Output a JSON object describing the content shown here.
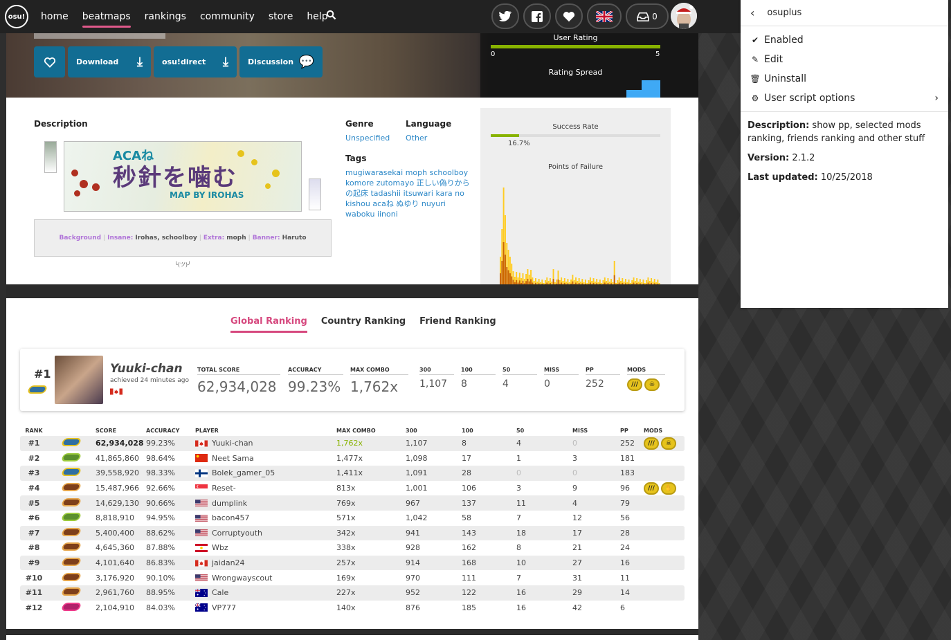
{
  "nav": {
    "logo": "osu!",
    "links": [
      "home",
      "beatmaps",
      "rankings",
      "community",
      "store",
      "help"
    ],
    "active": "beatmaps",
    "inbox_count": "0"
  },
  "header": {
    "buttons": {
      "download": "Download",
      "osudirect": "osu!direct",
      "discussion": "Discussion"
    },
    "user_rating": {
      "label": "User Rating",
      "min": "0",
      "max": "5"
    },
    "rating_spread": {
      "label": "Rating Spread"
    }
  },
  "info": {
    "description_label": "Description",
    "banner_text": {
      "line1": "ACAね",
      "line2": "秒針を噛む",
      "line3": "MAP BY IROHAS"
    },
    "credits": [
      {
        "key": "Background",
        "value": ""
      },
      {
        "key": "Insane:",
        "value": "Irohas, schoolboy"
      },
      {
        "key": "Extra:",
        "value": "moph"
      },
      {
        "key": "Banner:",
        "value": "Haruto"
      }
    ],
    "kaomoji": "╰(ツ)╯",
    "genre_label": "Genre",
    "genre_value": "Unspecified",
    "language_label": "Language",
    "language_value": "Other",
    "tags_label": "Tags",
    "tags": "mugiwarasekai moph schoolboy komore zutomayo 正しい偽りからの起床 tadashii itsuwari kara no kishou acaね ぬゆり nuyuri waboku iinoni",
    "success_rate_label": "Success Rate",
    "success_rate": "16.7%",
    "success_rate_value": 0.167,
    "points_of_failure_label": "Points of Failure"
  },
  "ranking": {
    "tabs": [
      "Global Ranking",
      "Country Ranking",
      "Friend Ranking"
    ],
    "active_tab": "Global Ranking",
    "top": {
      "rank": "#1",
      "name": "Yuuki-chan",
      "achieved": "achieved 24 minutes ago",
      "stats": [
        {
          "label": "TOTAL SCORE",
          "value": "62,934,028"
        },
        {
          "label": "ACCURACY",
          "value": "99.23%"
        },
        {
          "label": "MAX COMBO",
          "value": "1,762x"
        },
        {
          "label": "300",
          "value": "1,107"
        },
        {
          "label": "100",
          "value": "8"
        },
        {
          "label": "50",
          "value": "4"
        },
        {
          "label": "MISS",
          "value": "0"
        },
        {
          "label": "PP",
          "value": "252"
        },
        {
          "label": "MODS",
          "value": ""
        }
      ]
    },
    "headers": [
      "RANK",
      "",
      "SCORE",
      "ACCURACY",
      "PLAYER",
      "MAX COMBO",
      "300",
      "100",
      "50",
      "MISS",
      "PP",
      "MODS"
    ],
    "rows": [
      {
        "rank": "#1",
        "grade": "S",
        "score": "62,934,028",
        "acc": "99.23%",
        "flag": "ca",
        "player": "Yuuki-chan",
        "combo": "1,762x",
        "c300": "1,107",
        "c100": "8",
        "c50": "4",
        "miss": "0",
        "pp": "252",
        "mods": [
          "HR",
          "SD"
        ]
      },
      {
        "rank": "#2",
        "grade": "A",
        "score": "41,865,860",
        "acc": "98.64%",
        "flag": "cn",
        "player": "Neet Sama",
        "combo": "1,477x",
        "c300": "1,098",
        "c100": "17",
        "c50": "1",
        "miss": "3",
        "pp": "181",
        "mods": []
      },
      {
        "rank": "#3",
        "grade": "S",
        "score": "39,558,920",
        "acc": "98.33%",
        "flag": "fi",
        "player": "Bolek_gamer_05",
        "combo": "1,411x",
        "c300": "1,091",
        "c100": "28",
        "c50": "0",
        "miss": "0",
        "pp": "183",
        "mods": []
      },
      {
        "rank": "#4",
        "grade": "B",
        "score": "15,487,966",
        "acc": "92.66%",
        "flag": "sg",
        "player": "Reset-",
        "combo": "813x",
        "c300": "1,001",
        "c100": "106",
        "c50": "3",
        "miss": "9",
        "pp": "96",
        "mods": [
          "HR",
          "RX"
        ]
      },
      {
        "rank": "#5",
        "grade": "B",
        "score": "14,629,130",
        "acc": "90.66%",
        "flag": "us",
        "player": "dumplink",
        "combo": "769x",
        "c300": "967",
        "c100": "137",
        "c50": "11",
        "miss": "4",
        "pp": "79",
        "mods": []
      },
      {
        "rank": "#6",
        "grade": "A",
        "score": "8,818,910",
        "acc": "94.95%",
        "flag": "us",
        "player": "bacon457",
        "combo": "571x",
        "c300": "1,042",
        "c100": "58",
        "c50": "7",
        "miss": "12",
        "pp": "56",
        "mods": []
      },
      {
        "rank": "#7",
        "grade": "B",
        "score": "5,400,400",
        "acc": "88.62%",
        "flag": "us",
        "player": "Corruptyouth",
        "combo": "342x",
        "c300": "941",
        "c100": "143",
        "c50": "18",
        "miss": "17",
        "pp": "28",
        "mods": []
      },
      {
        "rank": "#8",
        "grade": "B",
        "score": "4,645,360",
        "acc": "87.88%",
        "flag": "pf",
        "player": "Wbz",
        "combo": "338x",
        "c300": "928",
        "c100": "162",
        "c50": "8",
        "miss": "21",
        "pp": "24",
        "mods": []
      },
      {
        "rank": "#9",
        "grade": "B",
        "score": "4,101,640",
        "acc": "86.83%",
        "flag": "ca",
        "player": "jaidan24",
        "combo": "257x",
        "c300": "914",
        "c100": "168",
        "c50": "10",
        "miss": "27",
        "pp": "16",
        "mods": []
      },
      {
        "rank": "#10",
        "grade": "B",
        "score": "3,176,920",
        "acc": "90.10%",
        "flag": "us",
        "player": "Wrongwayscout",
        "combo": "169x",
        "c300": "970",
        "c100": "111",
        "c50": "7",
        "miss": "31",
        "pp": "11",
        "mods": []
      },
      {
        "rank": "#11",
        "grade": "B",
        "score": "2,961,760",
        "acc": "88.95%",
        "flag": "au",
        "player": "Cale",
        "combo": "227x",
        "c300": "952",
        "c100": "122",
        "c50": "16",
        "miss": "29",
        "pp": "14",
        "mods": []
      },
      {
        "rank": "#12",
        "grade": "C",
        "score": "2,104,910",
        "acc": "84.03%",
        "flag": "au",
        "player": "VP777",
        "combo": "140x",
        "c300": "876",
        "c100": "185",
        "c50": "16",
        "miss": "42",
        "pp": "6",
        "mods": []
      }
    ]
  },
  "popup": {
    "title": "osuplus",
    "items": [
      {
        "icon": "check-icon",
        "label": "Enabled"
      },
      {
        "icon": "edit-icon",
        "label": "Edit"
      },
      {
        "icon": "trash-icon",
        "label": "Uninstall"
      },
      {
        "icon": "gears-icon",
        "label": "User script options"
      }
    ],
    "description_label": "Description:",
    "description": "show pp, selected mods ranking, friends ranking and other stuff",
    "version_label": "Version:",
    "version": "2.1.2",
    "updated_label": "Last updated:",
    "updated": "10/25/2018"
  },
  "colors": {
    "accent": "#d6487e",
    "link": "#2b87c7",
    "button": "#126d93",
    "rating": "#88b300",
    "fail_fail": "#ffcc22",
    "fail_exit": "#cc6600"
  }
}
